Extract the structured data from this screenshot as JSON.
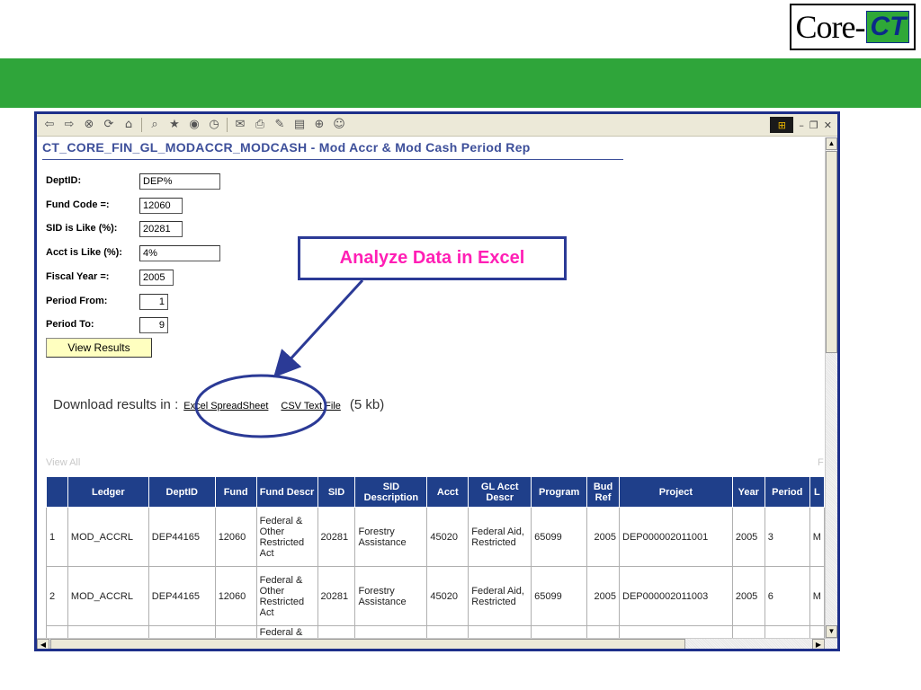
{
  "logo": {
    "core": "Core-",
    "ct": "CT"
  },
  "browser": {
    "page_title": "CT_CORE_FIN_GL_MODACCR_MODCASH - Mod Accr & Mod Cash Period Rep"
  },
  "form": {
    "dept_label": "DeptID:",
    "dept_value": "DEP%",
    "fund_label": "Fund Code =:",
    "fund_value": "12060",
    "sid_label": "SID is Like (%):",
    "sid_value": "20281",
    "acct_label": "Acct is Like (%):",
    "acct_value": "4%",
    "year_label": "Fiscal Year =:",
    "year_value": "2005",
    "from_label": "Period From:",
    "from_value": "1",
    "to_label": "Period To:",
    "to_value": "9",
    "view_button": "View Results"
  },
  "download": {
    "prefix": "Download results in :",
    "excel_link": "Excel SpreadSheet",
    "csv_link": "CSV Text File",
    "size": "(5 kb)"
  },
  "results": {
    "view_all": "View All",
    "right_marker": "F",
    "headers": [
      "",
      "Ledger",
      "DeptID",
      "Fund",
      "Fund Descr",
      "SID",
      "SID Description",
      "Acct",
      "GL Acct Descr",
      "Program",
      "Bud Ref",
      "Project",
      "Year",
      "Period",
      "L"
    ],
    "rows": [
      [
        "1",
        "MOD_ACCRL",
        "DEP44165",
        "12060",
        "Federal & Other Restricted Act",
        "20281",
        "Forestry Assistance",
        "45020",
        "Federal Aid, Restricted",
        "65099",
        "2005",
        "DEP000002011001",
        "2005",
        "3",
        "M"
      ],
      [
        "2",
        "MOD_ACCRL",
        "DEP44165",
        "12060",
        "Federal & Other Restricted Act",
        "20281",
        "Forestry Assistance",
        "45020",
        "Federal Aid, Restricted",
        "65099",
        "2005",
        "DEP000002011003",
        "2005",
        "6",
        "M"
      ]
    ],
    "partial_row_text": "Federal &"
  },
  "callout": {
    "text": "Analyze Data in Excel"
  },
  "colors": {
    "green_band": "#2fa53a",
    "browser_border": "#1d2f8a",
    "table_header": "#1f3f8a",
    "callout_text": "#ff1fb5",
    "view_button": "#ffffc0"
  }
}
